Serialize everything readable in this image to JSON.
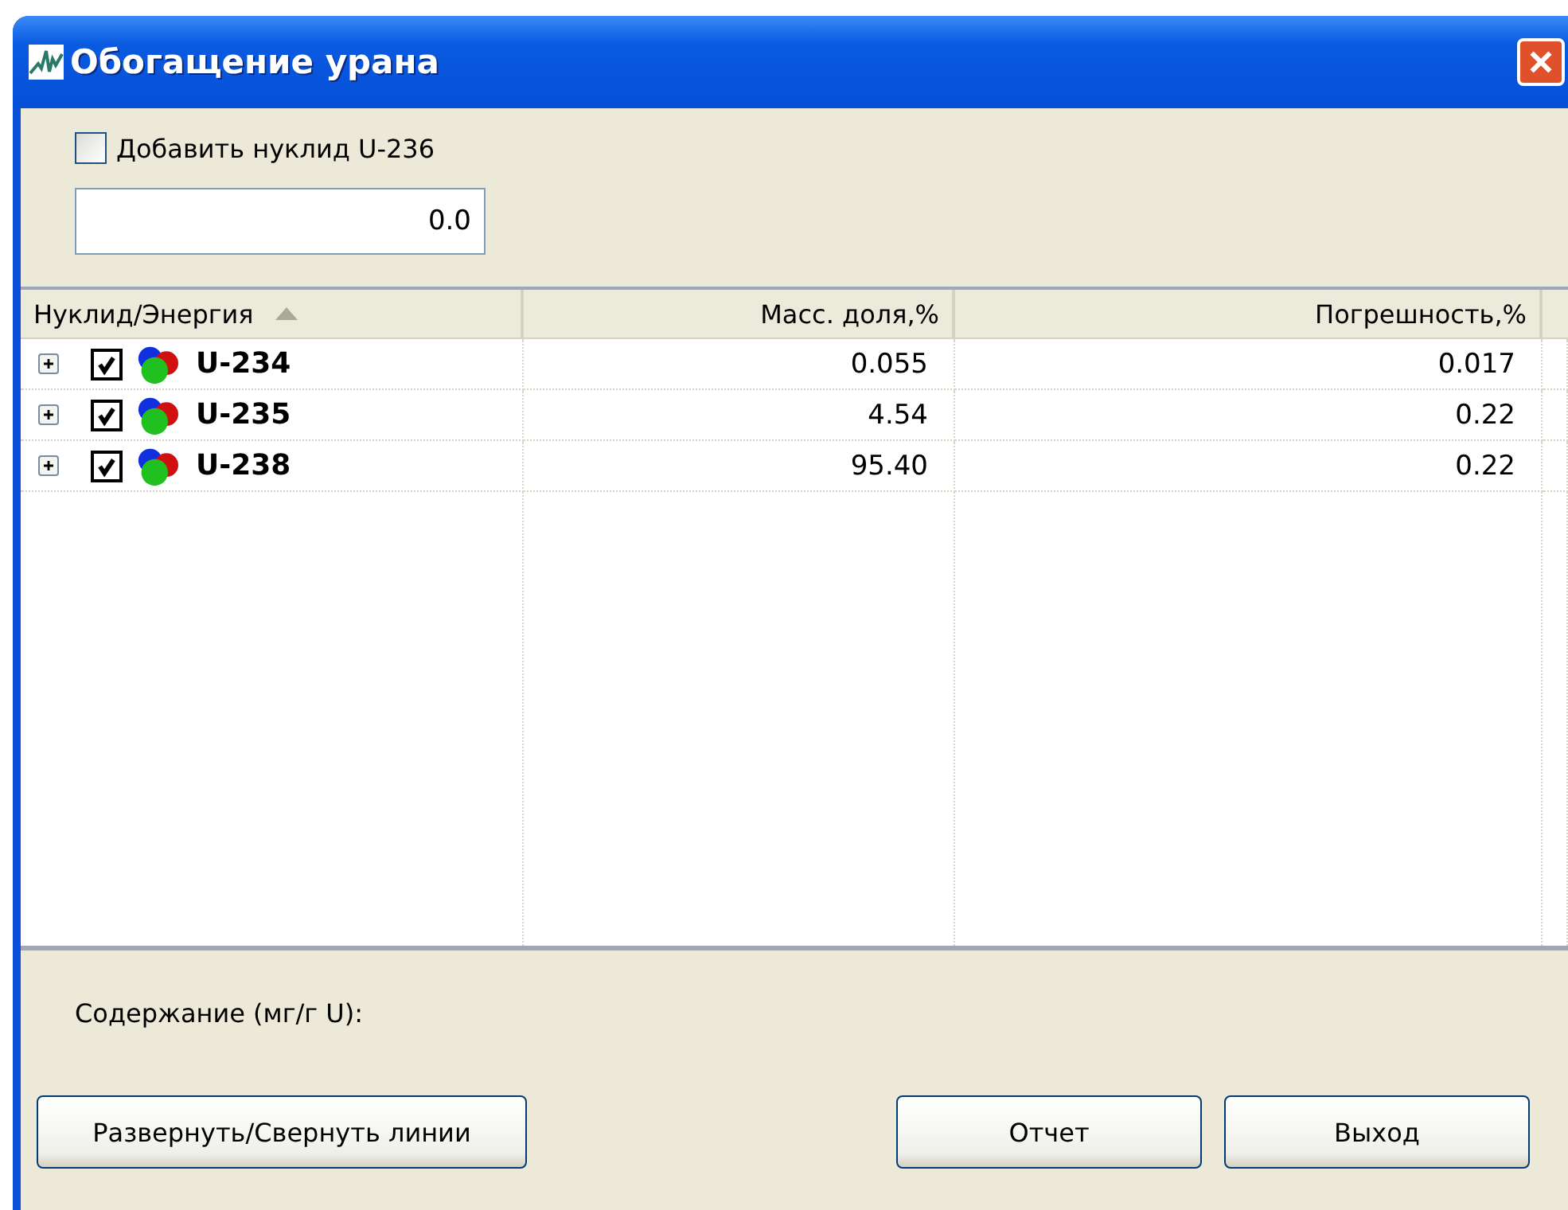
{
  "window": {
    "title": "Обогащение урана"
  },
  "add_nuclide": {
    "label": "Добавить нуклид U-236",
    "checked": false
  },
  "value_field": {
    "value": "0.0"
  },
  "table": {
    "columns": [
      {
        "label": "Нуклид/Энергия",
        "sorted": true
      },
      {
        "label": "Масс. доля,%",
        "sorted": false
      },
      {
        "label": "Погрешность,%",
        "sorted": false
      }
    ],
    "rows": [
      {
        "nuclide": "U-234",
        "checked": true,
        "expanded": false,
        "mass_fraction": "0.055",
        "error": "0.017"
      },
      {
        "nuclide": "U-235",
        "checked": true,
        "expanded": false,
        "mass_fraction": "4.54",
        "error": "0.22"
      },
      {
        "nuclide": "U-238",
        "checked": true,
        "expanded": false,
        "mass_fraction": "95.40",
        "error": "0.22"
      }
    ]
  },
  "content_label": "Содержание (мг/г U):",
  "buttons": [
    {
      "label": "Развернуть/Свернуть линии"
    },
    {
      "label": "Отчет"
    },
    {
      "label": "Выход"
    }
  ]
}
